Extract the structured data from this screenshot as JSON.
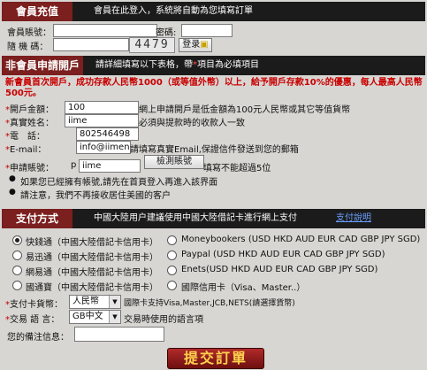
{
  "member": {
    "title": "會員充值",
    "desc": "會員在此登入，系統將自動為您填寫訂單",
    "account_label": "會員賬號：",
    "account_value": "",
    "password_label": "密碼:",
    "password_value": "",
    "captcha_label": "隨 機 碼：",
    "captcha_value": "",
    "captcha_code": "4479",
    "login_label": "登录"
  },
  "nonmember": {
    "title": "非會員申請開戶",
    "desc_a": "請詳細填寫以下表格，帶",
    "desc_star": "*",
    "desc_b": "項目為必填項目",
    "promo": "新會員首次開戶，成功存款人民幣1000（或等值外幣）以上，給予開戶存款10%的優惠，每人最高人民幣500元。",
    "amount_label": "開戶金額：",
    "amount_value": "100",
    "amount_note": "網上申請開戶是低金額為100元人民幣或其它等值貨幣",
    "name_label": "真實姓名：",
    "name_value": "iime",
    "name_note": "必須與提款時的收款人一致",
    "phone_label": "電　話：",
    "phone_value": "802546498",
    "email_label": "E-mail：",
    "email_value": "info@iimenez.com",
    "email_note": "請填寫真實Email,保證信件發送到您的郵箱",
    "apply_label": "申請賬號：",
    "apply_prefix": "p",
    "apply_value": "iime",
    "check_button": "檢測賬號",
    "apply_note": "填寫不能超過5位",
    "notice1": "如果您已經擁有帳號,請先在首頁登入再進入該界面",
    "notice2": "請注意，我們不再接收居住美國的客户"
  },
  "payment": {
    "title": "支付方式",
    "desc": "中國大陸用户建議使用中國大陸借記卡進行網上支付",
    "link": "支付說明",
    "options_left": [
      "快錢通（中國大陸借記卡信用卡）",
      "易迅通（中國大陸借記卡信用卡）",
      "網易通（中國大陸借記卡信用卡）",
      "國通寶（中國大陸借記卡信用卡）"
    ],
    "options_right": [
      "Moneybookers (USD HKD AUD EUR CAD GBP JPY SGD)",
      "Paypal (USD HKD AUD EUR CAD GBP JPY SGD)",
      "Enets(USD HKD AUD EUR CAD GBP JPY SGD)",
      "國際信用卡（Visa、Master..）"
    ],
    "currency_label": "支付卡貨幣：",
    "currency_value": "人民幣",
    "currency_note": "國際卡支持Visa,Master,JCB,NETS(請選擇貨幣)",
    "language_label": "交易 語 言：",
    "language_value": "GB中文",
    "language_note": "交易時使用的語言項",
    "remark_label": "您的備注信息：",
    "remark_value": "",
    "submit": "提交訂單"
  }
}
